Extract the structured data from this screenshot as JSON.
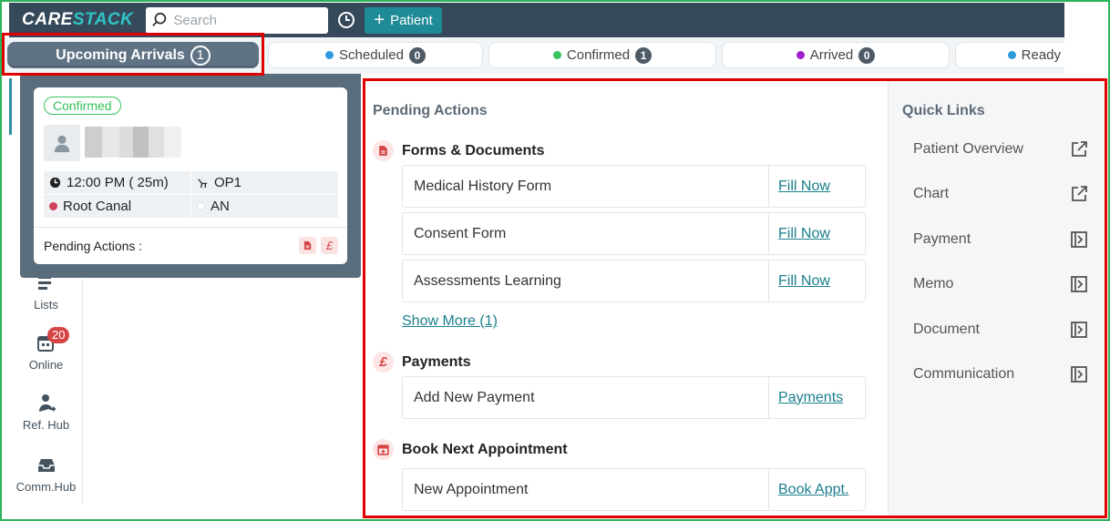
{
  "topbar": {
    "logo_main": "CARE",
    "logo_accent": "STACK",
    "search_placeholder": "Search",
    "patient_button": "Patient"
  },
  "status_tabs": {
    "upcoming": {
      "label": "Upcoming Arrivals",
      "count": "1"
    },
    "scheduled": {
      "label": "Scheduled",
      "count": "0",
      "color": "#2d9cdb"
    },
    "confirmed": {
      "label": "Confirmed",
      "count": "1",
      "color": "#37c25a"
    },
    "arrived": {
      "label": "Arrived",
      "count": "0",
      "color": "#a020d0"
    },
    "ready": {
      "label": "Ready",
      "color": "#2d9cdb"
    }
  },
  "sidebar": {
    "items": [
      {
        "label": "Lists",
        "icon": "list-icon"
      },
      {
        "label": "Online",
        "icon": "calendar-icon",
        "badge": "20"
      },
      {
        "label": "Ref. Hub",
        "icon": "referral-icon"
      },
      {
        "label": "Comm.Hub",
        "icon": "inbox-icon"
      }
    ]
  },
  "appointment_card": {
    "status": "Confirmed",
    "time": "12:00 PM ( 25m)",
    "operatory": "OP1",
    "procedure": "Root Canal",
    "provider": "AN",
    "pending_label": "Pending Actions :",
    "currency_symbol": "£"
  },
  "pending_actions": {
    "title": "Pending Actions",
    "forms": {
      "title": "Forms & Documents",
      "items": [
        {
          "name": "Medical History Form",
          "action": "Fill Now"
        },
        {
          "name": "Consent Form",
          "action": "Fill Now"
        },
        {
          "name": "Assessments Learning",
          "action": "Fill Now"
        }
      ],
      "show_more": "Show More (1)"
    },
    "payments": {
      "title": "Payments",
      "symbol": "£",
      "items": [
        {
          "name": "Add New Payment",
          "action": "Payments"
        }
      ]
    },
    "book": {
      "title": "Book Next Appointment",
      "items": [
        {
          "name": "New Appointment",
          "action": "Book Appt."
        }
      ]
    }
  },
  "quick_links": {
    "title": "Quick Links",
    "items": [
      {
        "label": "Patient Overview",
        "icon": "external-link-icon"
      },
      {
        "label": "Chart",
        "icon": "external-link-icon"
      },
      {
        "label": "Payment",
        "icon": "panel-open-icon"
      },
      {
        "label": "Memo",
        "icon": "panel-open-icon"
      },
      {
        "label": "Document",
        "icon": "panel-open-icon"
      },
      {
        "label": "Communication",
        "icon": "panel-open-icon"
      }
    ]
  }
}
